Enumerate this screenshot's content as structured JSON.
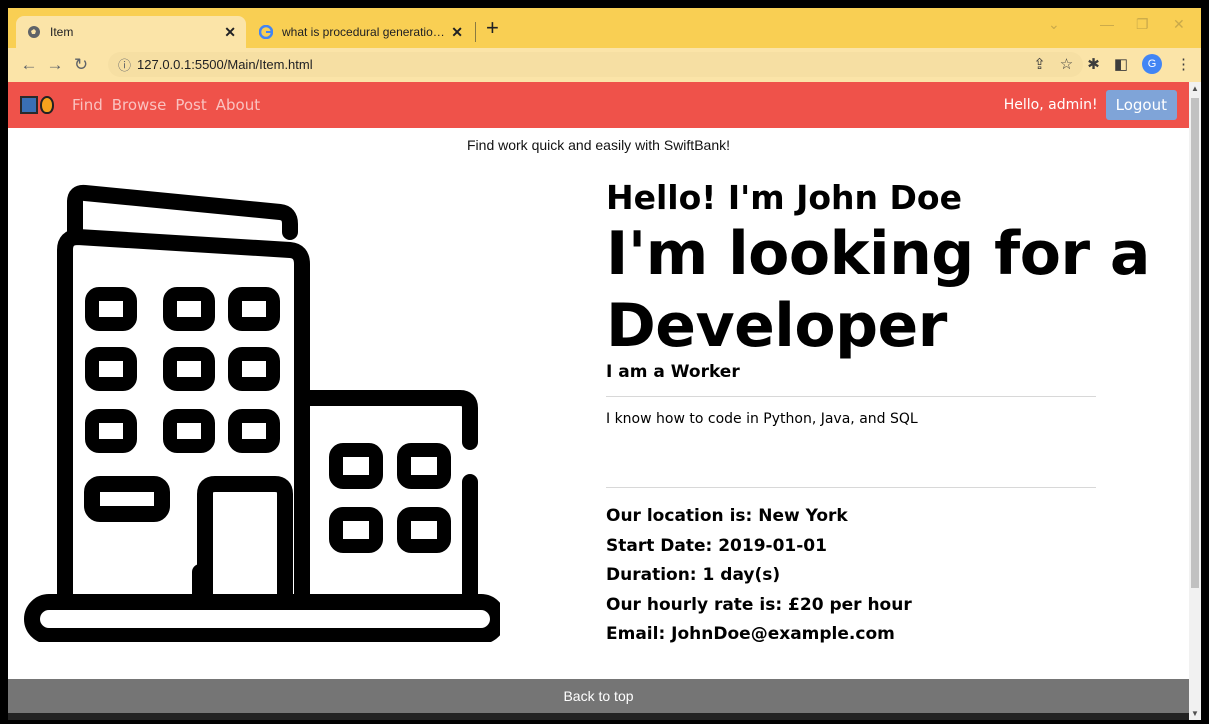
{
  "browser": {
    "tabs": [
      {
        "title": "Item",
        "active": true
      },
      {
        "title": "what is procedural generation - G",
        "active": false
      }
    ],
    "url": "127.0.0.1:5500/Main/Item.html",
    "accent": "#f9cf53"
  },
  "navbar": {
    "links": [
      "Find",
      "Browse",
      "Post",
      "About"
    ],
    "greeting": "Hello, admin!",
    "logout_label": "Logout",
    "color": "#ef524a"
  },
  "tagline": "Find work quick and easily with SwiftBank!",
  "listing": {
    "hello": "Hello! I'm John Doe",
    "role_line1": "I'm looking for a",
    "role_line2": "Developer",
    "subrole": "I am a Worker",
    "description": "I know how to code in Python, Java, and SQL",
    "location": "Our location is: New York",
    "start_date": "Start Date: 2019-01-01",
    "duration": "Duration: 1 day(s)",
    "rate": "Our hourly rate is: £20 per hour",
    "email": "Email: JohnDoe@example.com"
  },
  "footer": {
    "back_to_top": "Back to top"
  }
}
